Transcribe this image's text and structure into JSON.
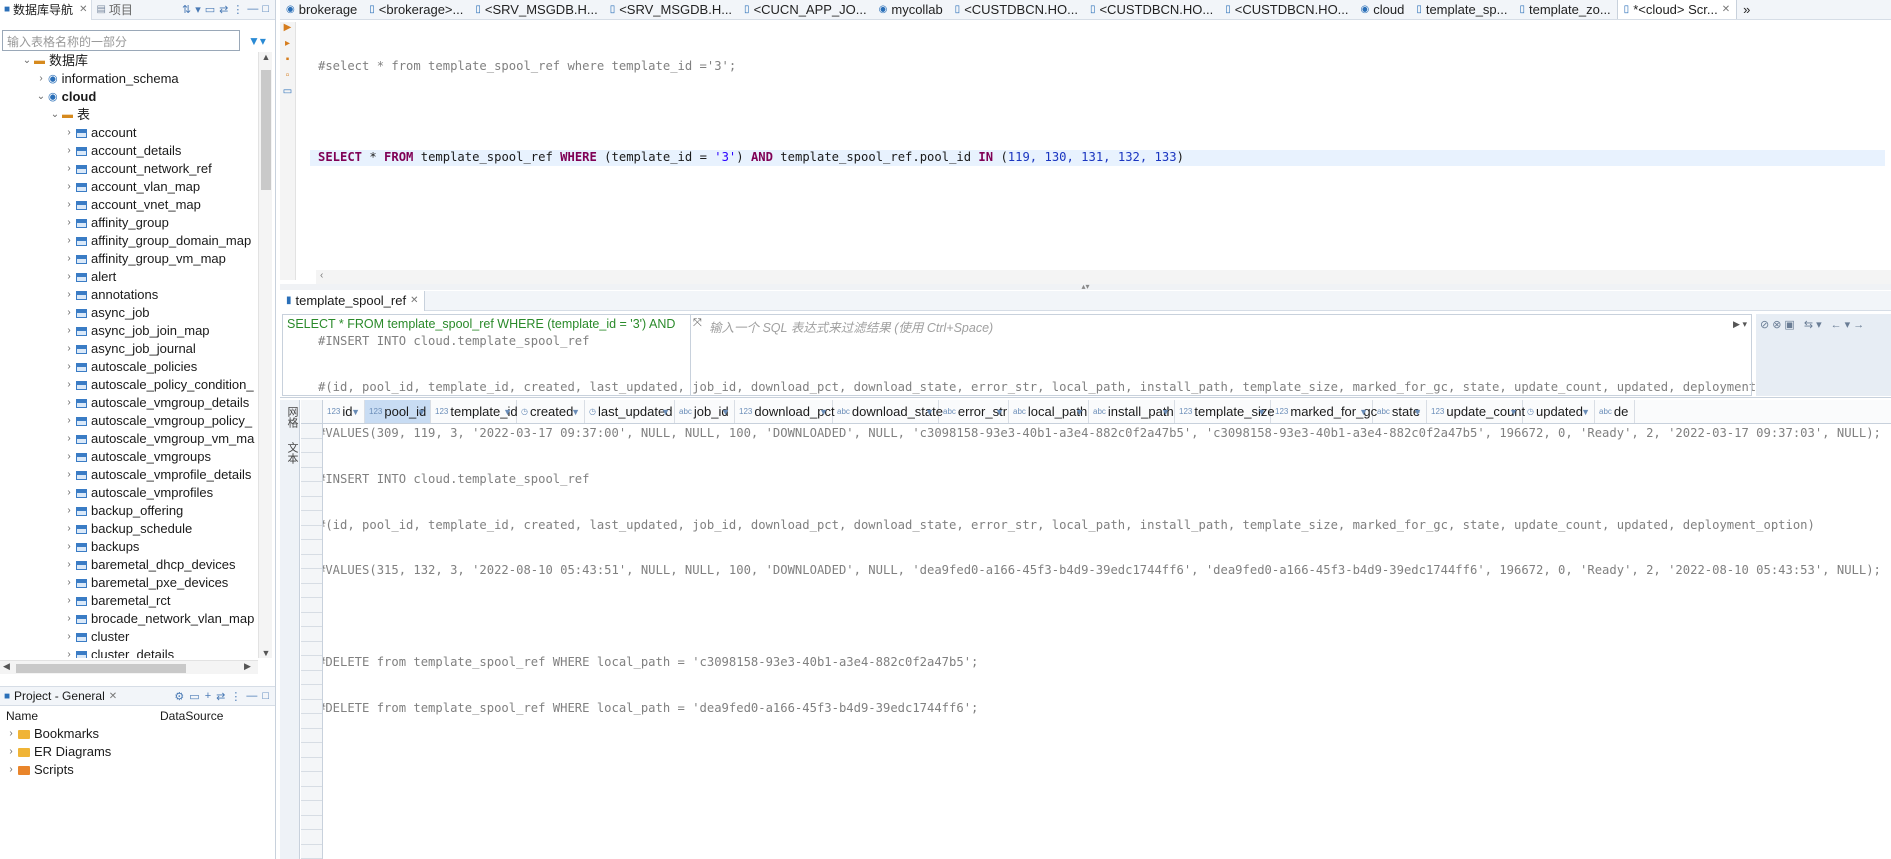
{
  "navigator": {
    "tab_db": "数据库导航",
    "tab_project": "项目",
    "filter_placeholder": "输入表格名称的一部分",
    "tree": {
      "root": "数据库",
      "schema1": "information_schema",
      "schema2": "cloud",
      "tables_folder": "表",
      "tables": [
        "account",
        "account_details",
        "account_network_ref",
        "account_vlan_map",
        "account_vnet_map",
        "affinity_group",
        "affinity_group_domain_map",
        "affinity_group_vm_map",
        "alert",
        "annotations",
        "async_job",
        "async_job_join_map",
        "async_job_journal",
        "autoscale_policies",
        "autoscale_policy_condition_",
        "autoscale_vmgroup_details",
        "autoscale_vmgroup_policy_",
        "autoscale_vmgroup_vm_ma",
        "autoscale_vmgroups",
        "autoscale_vmprofile_details",
        "autoscale_vmprofiles",
        "backup_offering",
        "backup_schedule",
        "backups",
        "baremetal_dhcp_devices",
        "baremetal_pxe_devices",
        "baremetal_rct",
        "brocade_network_vlan_map",
        "cluster",
        "cluster_details"
      ]
    }
  },
  "project": {
    "title": "Project - General",
    "col_name": "Name",
    "col_datasource": "DataSource",
    "items": [
      "Bookmarks",
      "ER Diagrams",
      "Scripts"
    ]
  },
  "editor_tabs": [
    "brokerage",
    "<brokerage>...",
    "<SRV_MSGDB.H...",
    "<SRV_MSGDB.H...",
    "<CUCN_APP_JO...",
    "mycollab",
    "<CUSTDBCN.HO...",
    "<CUSTDBCN.HO...",
    "<CUSTDBCN.HO...",
    "cloud",
    "template_sp...",
    "template_zo...",
    "*<cloud> Scr..."
  ],
  "editor_overflow": "»",
  "code": {
    "l1": "#select * from template_spool_ref where template_id ='3';",
    "l3_kw1": "SELECT",
    "l3_t1": " * ",
    "l3_kw2": "FROM",
    "l3_t2": " template_spool_ref ",
    "l3_kw3": "WHERE",
    "l3_t3": " (template_id = ",
    "l3_s1": "'3'",
    "l3_t4": ") ",
    "l3_kw4": "AND",
    "l3_t5": " template_spool_ref.pool_id ",
    "l3_kw5": "IN",
    "l3_t6": " (",
    "l3_nums": "119, 130, 131, 132, 133",
    "l3_t7": ")",
    "l7": "#INSERT INTO cloud.template_spool_ref",
    "l8": "#(id, pool_id, template_id, created, last_updated, job_id, download_pct, download_state, error_str, local_path, install_path, template_size, marked_for_gc, state, update_count, updated, deployment_option)",
    "l9": "#VALUES(309, 119, 3, '2022-03-17 09:37:00', NULL, NULL, 100, 'DOWNLOADED', NULL, 'c3098158-93e3-40b1-a3e4-882c0f2a47b5', 'c3098158-93e3-40b1-a3e4-882c0f2a47b5', 196672, 0, 'Ready', 2, '2022-03-17 09:37:03', NULL);",
    "l10": "#INSERT INTO cloud.template_spool_ref",
    "l11": "#(id, pool_id, template_id, created, last_updated, job_id, download_pct, download_state, error_str, local_path, install_path, template_size, marked_for_gc, state, update_count, updated, deployment_option)",
    "l12": "#VALUES(315, 132, 3, '2022-08-10 05:43:51', NULL, NULL, 100, 'DOWNLOADED', NULL, 'dea9fed0-a166-45f3-b4d9-39edc1744ff6', 'dea9fed0-a166-45f3-b4d9-39edc1744ff6', 196672, 0, 'Ready', 2, '2022-08-10 05:43:53', NULL);",
    "l14": "#DELETE from template_spool_ref WHERE local_path = 'c3098158-93e3-40b1-a3e4-882c0f2a47b5';",
    "l15": "#DELETE from template_spool_ref WHERE local_path = 'dea9fed0-a166-45f3-b4d9-39edc1744ff6';"
  },
  "results": {
    "tab": "template_spool_ref",
    "query_preview": "SELECT * FROM template_spool_ref WHERE (template_id = '3') AND",
    "filter_placeholder": "输入一个 SQL 表达式来过滤结果 (使用 Ctrl+Space)",
    "side_label_grid": "网格",
    "side_label_text": "文本",
    "columns": [
      {
        "name": "id",
        "type": "123"
      },
      {
        "name": "pool_id",
        "type": "123"
      },
      {
        "name": "template_id",
        "type": "123"
      },
      {
        "name": "created",
        "type": "clock"
      },
      {
        "name": "last_updated",
        "type": "clock"
      },
      {
        "name": "job_id",
        "type": "abc"
      },
      {
        "name": "download_pct",
        "type": "123"
      },
      {
        "name": "download_state",
        "type": "abc"
      },
      {
        "name": "error_str",
        "type": "abc"
      },
      {
        "name": "local_path",
        "type": "abc"
      },
      {
        "name": "install_path",
        "type": "abc"
      },
      {
        "name": "template_size",
        "type": "123"
      },
      {
        "name": "marked_for_gc",
        "type": "123"
      },
      {
        "name": "state",
        "type": "abc"
      },
      {
        "name": "update_count",
        "type": "123"
      },
      {
        "name": "updated",
        "type": "clock"
      },
      {
        "name": "de",
        "type": "abc"
      }
    ],
    "selected_column": "pool_id"
  }
}
